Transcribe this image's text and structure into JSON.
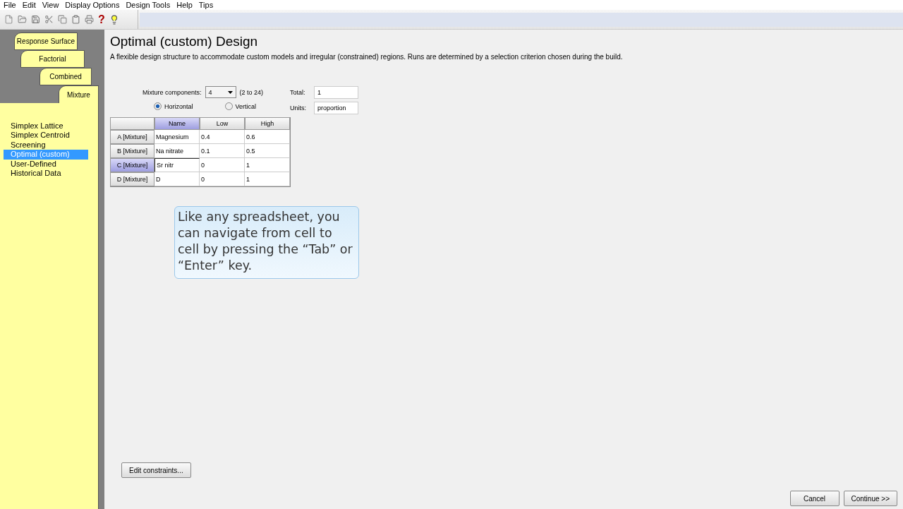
{
  "menu": [
    "File",
    "Edit",
    "View",
    "Display Options",
    "Design Tools",
    "Help",
    "Tips"
  ],
  "toolbar": {
    "help_glyph": "?"
  },
  "design_tabs": [
    {
      "label": "Response Surface",
      "selected": false
    },
    {
      "label": "Factorial",
      "selected": false
    },
    {
      "label": "Combined",
      "selected": false
    },
    {
      "label": "Mixture",
      "selected": true
    }
  ],
  "design_list": [
    {
      "label": "Simplex Lattice",
      "selected": false
    },
    {
      "label": "Simplex Centroid",
      "selected": false
    },
    {
      "label": "Screening",
      "selected": false
    },
    {
      "label": "Optimal (custom)",
      "selected": true
    },
    {
      "label": "User-Defined",
      "selected": false
    },
    {
      "label": "Historical Data",
      "selected": false
    }
  ],
  "title": "Optimal (custom) Design",
  "description": "A flexible design structure to accommodate custom models and irregular (constrained) regions.  Runs are determined by a selection criterion chosen during the build.",
  "mixture_components": {
    "label": "Mixture components:",
    "value": "4",
    "range": "(2 to 24)"
  },
  "orientation": [
    {
      "label": "Horizontal",
      "selected": true
    },
    {
      "label": "Vertical",
      "selected": false
    }
  ],
  "total": {
    "label": "Total:",
    "value": "1"
  },
  "units": {
    "label": "Units:",
    "value": "proportion"
  },
  "table": {
    "columns": [
      {
        "label": "Name",
        "selected": true
      },
      {
        "label": "Low",
        "selected": false
      },
      {
        "label": "High",
        "selected": false
      }
    ],
    "rows": [
      {
        "header": "A [Mixture]",
        "selected": false,
        "cells": [
          "Magnesium",
          "0.4",
          "0.6"
        ]
      },
      {
        "header": "B [Mixture]",
        "selected": false,
        "cells": [
          "Na nitrate",
          "0.1",
          "0.5"
        ]
      },
      {
        "header": "C [Mixture]",
        "selected": true,
        "cells": [
          "Sr nitr",
          "0",
          "1"
        ]
      },
      {
        "header": "D [Mixture]",
        "selected": false,
        "cells": [
          "D",
          "0",
          "1"
        ]
      }
    ]
  },
  "callout": "Like any spreadsheet, you can navigate from cell to cell by pressing the  “Tab” or “Enter” key.",
  "edit_constraints": "Edit constraints...",
  "buttons": [
    "Cancel",
    "Continue >>"
  ]
}
